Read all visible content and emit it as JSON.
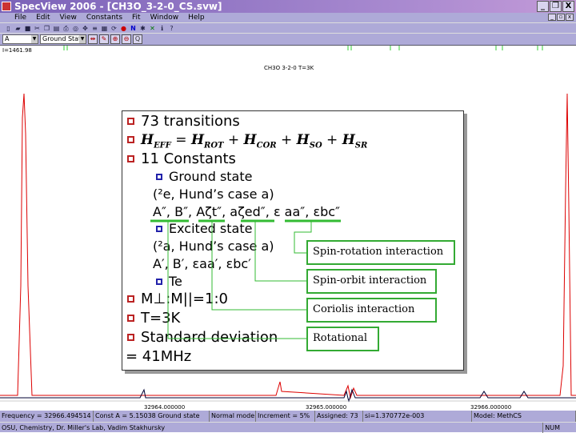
{
  "window": {
    "title": "SpecView 2006 - [CH3O_3-2-0_CS.svw]",
    "buttons": [
      "_",
      "❐",
      "X"
    ]
  },
  "menu": [
    "File",
    "Edit",
    "View",
    "Constants",
    "Fit",
    "Window",
    "Help"
  ],
  "toolbar2": {
    "constant_select": "A",
    "state_select": "Ground State"
  },
  "plot": {
    "readout": "I=1461.98",
    "title": "CH3O 3-2-0 T=3K",
    "x_ticks": [
      "32964.000000",
      "32965.000000",
      "32966.000000"
    ]
  },
  "status": {
    "frequency": "Frequency = 32966.494514",
    "constant": "Const A = 5.15038 Ground state",
    "mode": "Normal mode",
    "increment": "Increment = 5%",
    "assigned": "Assigned: 73",
    "si": "si=1.370772e-003",
    "model": "Model: MethCS"
  },
  "footer": {
    "credit": "OSU, Chemistry, Dr. Miller's Lab, Vadim Stakhursky",
    "num": "NUM"
  },
  "slide": {
    "transitions": "73 transitions",
    "heff": {
      "H": "H",
      "EFF": "EFF",
      "eq": " = ",
      "ROT": "ROT",
      "COR": "COR",
      "SO": "SO",
      "SR": "SR",
      "plus": " + "
    },
    "constants": "11 Constants",
    "ground": "Ground state",
    "ground_case": "(²e, Hund’s case a)",
    "ground_params": "A″, B″, Aζt″, aζed″, ε aa″, εbc″",
    "excited": "Excited state",
    "excited_case": "(²a, Hund’s case a)",
    "excited_params": "A′, B′, εaa′, εbc′",
    "te": "Te",
    "ratio": "M⊥:M||=1:0",
    "temp": "T=3K",
    "stddev": "Standard deviation",
    "stddev_val": "= 41MHz"
  },
  "callouts": [
    "Spin-rotation interaction",
    "Spin-orbit interaction",
    "Coriolis interaction",
    "Rotational"
  ]
}
